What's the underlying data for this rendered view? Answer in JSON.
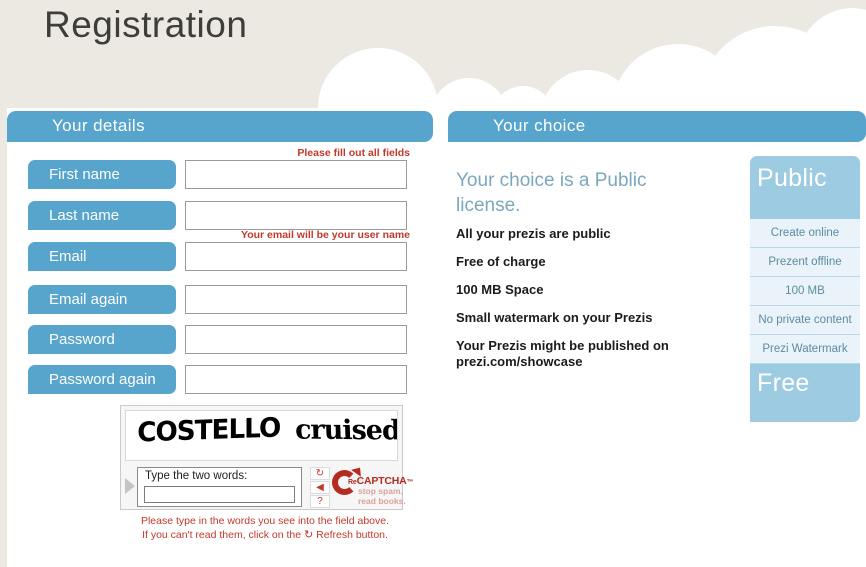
{
  "page": {
    "title": "Registration"
  },
  "colors": {
    "header_blue": "#57a4cc",
    "card_blue": "#9ccbe2",
    "banner_beige": "#ece9e3",
    "hint_red": "#c0392b",
    "heading_blue": "#7ba7bd",
    "row_bg": "#eaf3f9"
  },
  "details_panel": {
    "header": "Your details",
    "fields": [
      {
        "label": "First name",
        "value": "",
        "hint": "Please fill out all fields"
      },
      {
        "label": "Last name",
        "value": "",
        "hint": ""
      },
      {
        "label": "Email",
        "value": "",
        "hint": "Your email will be your user name"
      },
      {
        "label": "Email again",
        "value": "",
        "hint": ""
      },
      {
        "label": "Password",
        "value": "",
        "hint": ""
      },
      {
        "label": "Password again",
        "value": "",
        "hint": ""
      }
    ]
  },
  "captcha": {
    "words": "COSTELLO cruised",
    "word_one": "COSTELLO",
    "word_two": "cruised",
    "entry_label": "Type the two words:",
    "entry_value": "",
    "refresh_icon": "↻",
    "audio_icon": "◀",
    "help_icon": "?",
    "brand_prefix": "Re",
    "brand_name": "CAPTCHA",
    "brand_tm": "™",
    "tagline_line1": "stop spam.",
    "tagline_line2": "read books.",
    "instructions_line1": "Please type in the words you see into the field above.",
    "instructions_line2_before": "If you can't read them, click on the",
    "instructions_refresh_icon": "↻",
    "instructions_line2_after": "Refresh button."
  },
  "choice_panel": {
    "header": "Your choice",
    "heading": "Your choice is a Public license.",
    "features": [
      "All your prezis are public",
      "Free of charge",
      "100 MB Space",
      "Small watermark on your Prezis",
      "Your Prezis might be published on prezi.com/showcase"
    ],
    "license_card": {
      "title": "Public",
      "rows": [
        "Create online",
        "Prezent offline",
        "100 MB",
        "No private content",
        "Prezi Watermark"
      ],
      "footer": "Free"
    }
  }
}
